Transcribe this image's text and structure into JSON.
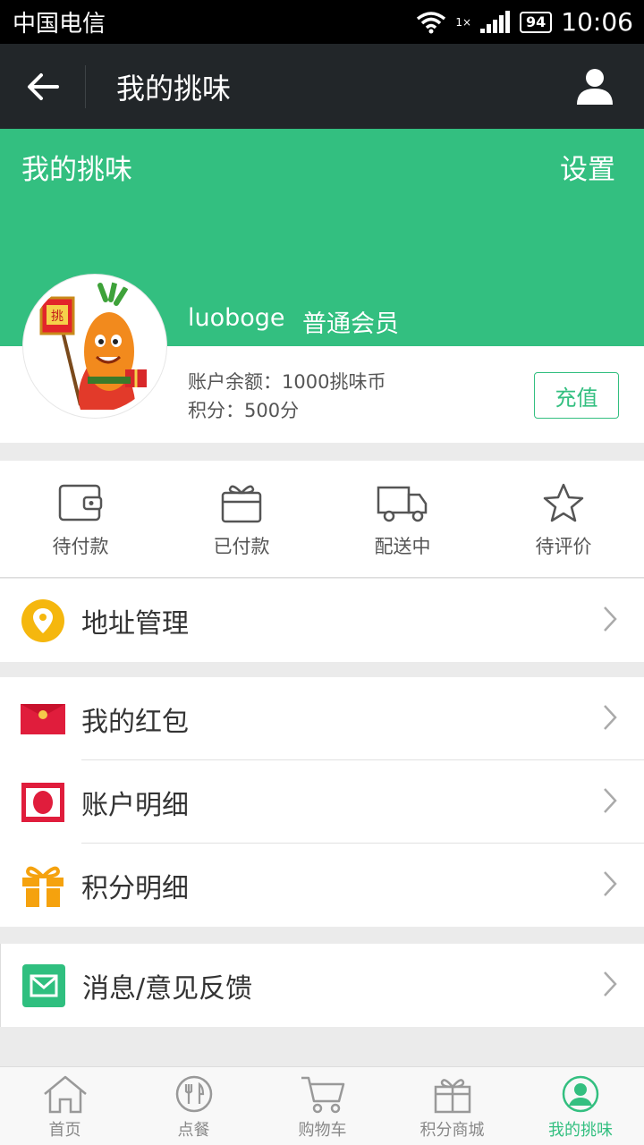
{
  "status_bar": {
    "carrier": "中国电信",
    "network": "1×",
    "battery": "94",
    "time": "10:06"
  },
  "header": {
    "title": "我的挑味"
  },
  "banner": {
    "title": "我的挑味",
    "settings": "设置",
    "username": "luoboge",
    "member_level": "普通会员",
    "background_color": "#33bf80"
  },
  "account": {
    "balance": "账户余额：1000挑味币",
    "points": "积分：500分",
    "recharge": "充值"
  },
  "orders": [
    {
      "label": "待付款",
      "icon": "wallet-icon"
    },
    {
      "label": "已付款",
      "icon": "gift-box-icon"
    },
    {
      "label": "配送中",
      "icon": "truck-icon"
    },
    {
      "label": "待评价",
      "icon": "star-icon"
    }
  ],
  "menu": {
    "address": "地址管理",
    "red_packet": "我的红包",
    "account_detail": "账户明细",
    "points_detail": "积分明细",
    "feedback": "消息/意见反馈"
  },
  "bottom_nav": [
    {
      "label": "首页",
      "icon": "home-icon"
    },
    {
      "label": "点餐",
      "icon": "utensils-icon"
    },
    {
      "label": "购物车",
      "icon": "cart-icon"
    },
    {
      "label": "积分商城",
      "icon": "gift-icon"
    },
    {
      "label": "我的挑味",
      "icon": "user-icon",
      "active": true
    }
  ],
  "accent_color": "#33bf80"
}
